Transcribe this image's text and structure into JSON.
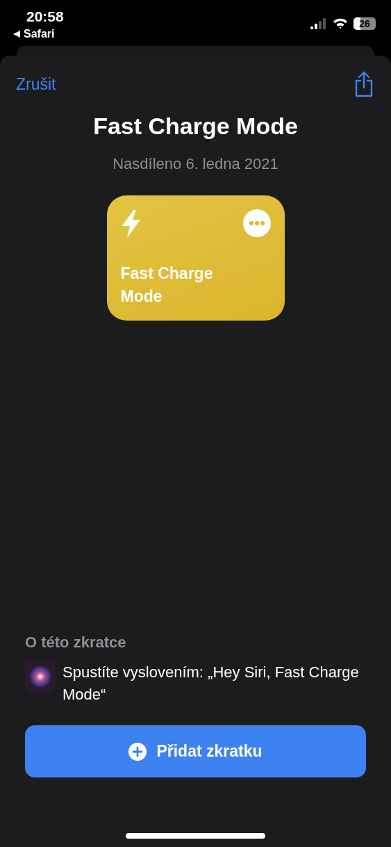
{
  "status_bar": {
    "time": "20:58",
    "back_app": "Safari",
    "battery": "26"
  },
  "sheet": {
    "cancel": "Zrušit",
    "title": "Fast Charge Mode",
    "shared": "Nasdíleno 6. ledna 2021"
  },
  "shortcut_card": {
    "name": "Fast Charge Mode"
  },
  "about": {
    "heading": "O této zkratce",
    "siri_phrase": "Spustíte vyslovením: „Hey Siri, Fast Charge Mode“"
  },
  "add_button": {
    "label": "Přidat zkratku"
  }
}
